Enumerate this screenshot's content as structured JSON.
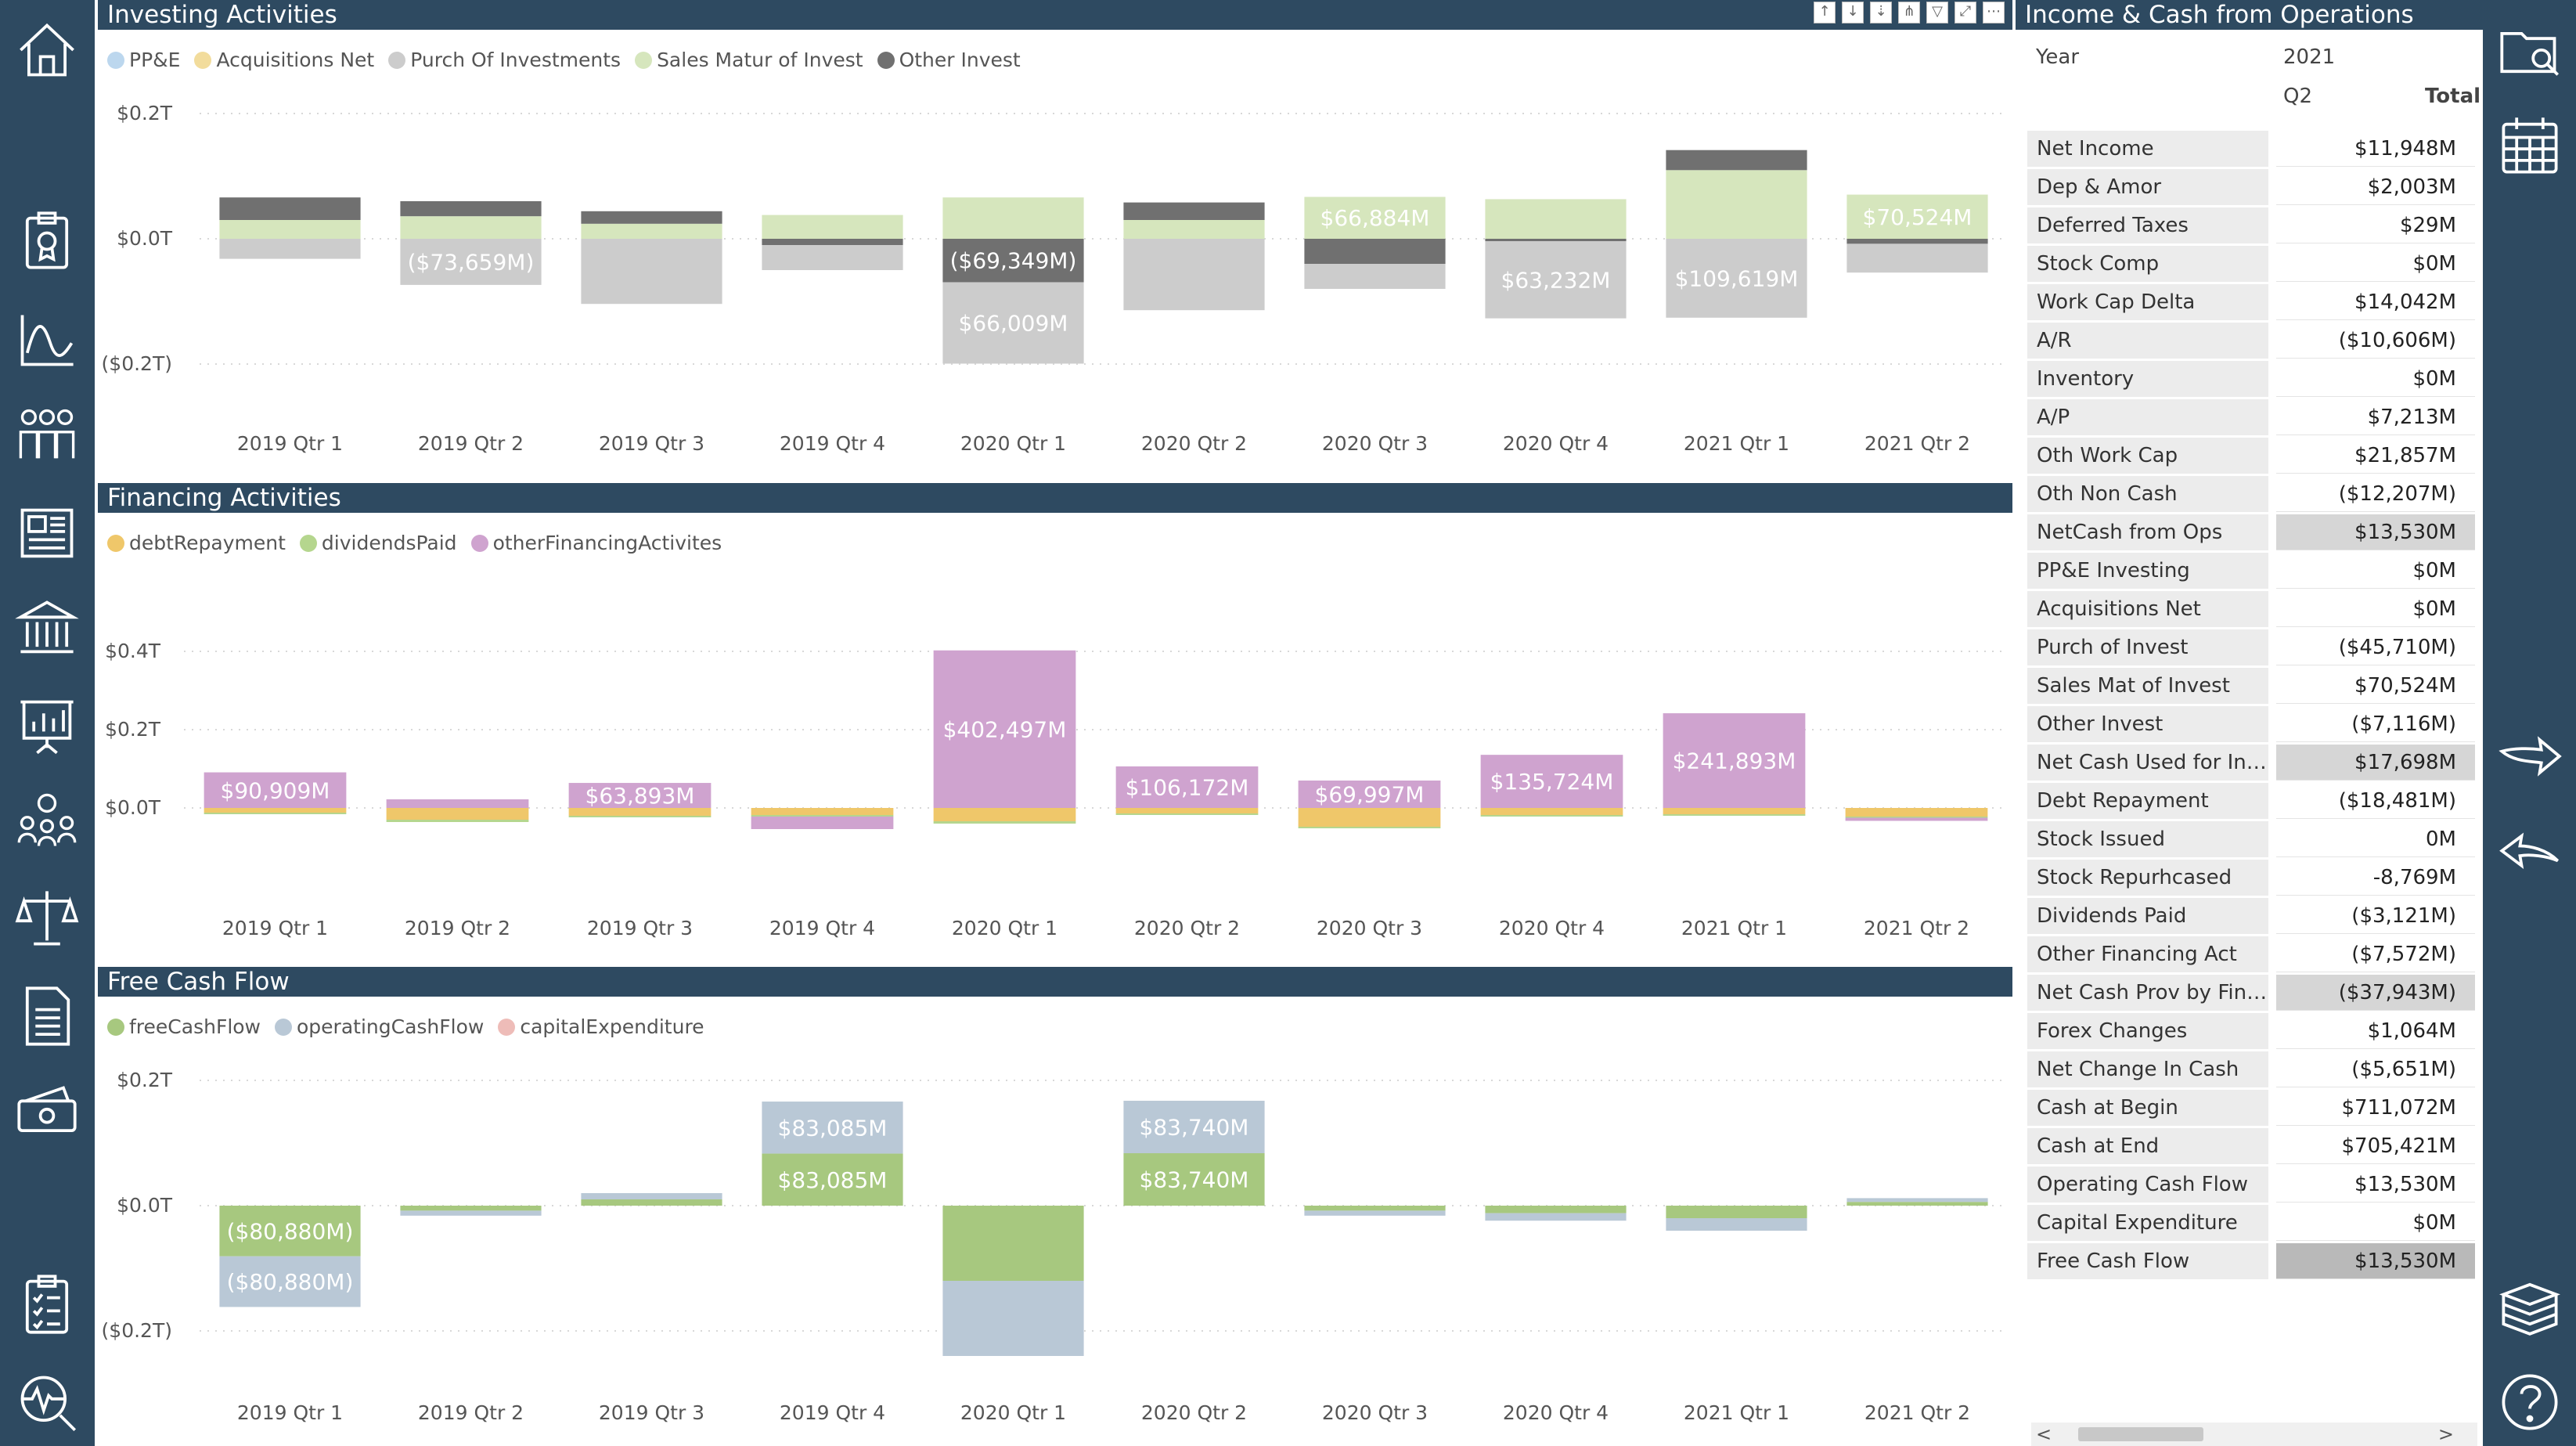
{
  "left_rail": {
    "icons": [
      "home-icon",
      "clipboard-award-icon",
      "line-chart-icon",
      "people-group-icon",
      "newspaper-icon",
      "bank-icon",
      "presentation-icon",
      "team-idea-icon",
      "scales-icon",
      "document-icon",
      "money-icon",
      "checklist-icon",
      "health-monitor-icon"
    ]
  },
  "right_rail": {
    "icons": [
      "folder-search-icon",
      "calendar-icon",
      "arrow-right-icon",
      "arrow-left-icon",
      "books-stack-icon",
      "help-icon"
    ]
  },
  "colors": {
    "header_bg": "#2e4a61",
    "ppe": "#bcd7ee",
    "acq_net": "#f2dc9c",
    "purch_invest": "#cccccc",
    "sales_matur": "#d6e6bd",
    "other_invest": "#707070",
    "debt_repayment": "#efc76a",
    "dividends_paid": "#b5d68e",
    "other_financing": "#cfa3cf",
    "free_cash_flow": "#a7c87f",
    "operating_cash_flow": "#b9c8d6",
    "capital_expenditure": "#eebcb8"
  },
  "investing": {
    "title": "Investing Activities",
    "legend": [
      "PP&E",
      "Acquisitions Net",
      "Purch Of Investments",
      "Sales Matur of Invest",
      "Other Invest"
    ]
  },
  "financing": {
    "title": "Financing Activities",
    "legend": [
      "debtRepayment",
      "dividendsPaid",
      "otherFinancingActivites"
    ]
  },
  "fcf": {
    "title": "Free Cash Flow",
    "legend": [
      "freeCashFlow",
      "operatingCashFlow",
      "capitalExpenditure"
    ]
  },
  "chart_data": [
    {
      "type": "bar",
      "stacked": true,
      "title": "Investing Activities",
      "categories": [
        "2019 Qtr 1",
        "2019 Qtr 2",
        "2019 Qtr 3",
        "2019 Qtr 4",
        "2020 Qtr 1",
        "2020 Qtr 2",
        "2020 Qtr 3",
        "2020 Qtr 4",
        "2021 Qtr 1",
        "2021 Qtr 2"
      ],
      "y_tick_labels": [
        "$0.2T",
        "$0.0T",
        "($0.2T)"
      ],
      "ylim": [
        -0.2,
        0.2
      ],
      "grid": true,
      "legend_position": "top-left",
      "series": [
        {
          "name": "Sales Matur of Invest",
          "values": [
            30000,
            36000,
            24000,
            38000,
            66009,
            30000,
            66884,
            63232,
            109619,
            70524
          ]
        },
        {
          "name": "Other Invest",
          "values": [
            36000,
            24000,
            20000,
            -10000,
            -69349,
            28000,
            -40000,
            -4000,
            32000,
            -8000
          ]
        },
        {
          "name": "Purch Of Investments",
          "values": [
            -32000,
            -73659,
            -104000,
            -40000,
            -130000,
            -114000,
            -40000,
            -123000,
            -126000,
            -46000
          ]
        }
      ],
      "data_labels": [
        {
          "category": "2019 Qtr 2",
          "text": "($73,659M)"
        },
        {
          "category": "2020 Qtr 1",
          "text": "$66,009M"
        },
        {
          "category": "2020 Qtr 1",
          "text": "($69,349M)"
        },
        {
          "category": "2020 Qtr 3",
          "text": "$66,884M"
        },
        {
          "category": "2020 Qtr 4",
          "text": "$63,232M"
        },
        {
          "category": "2021 Qtr 1",
          "text": "$109,619M"
        },
        {
          "category": "2021 Qtr 2",
          "text": "$70,524M"
        }
      ]
    },
    {
      "type": "bar",
      "stacked": true,
      "title": "Financing Activities",
      "categories": [
        "2019 Qtr 1",
        "2019 Qtr 2",
        "2019 Qtr 3",
        "2019 Qtr 4",
        "2020 Qtr 1",
        "2020 Qtr 2",
        "2020 Qtr 3",
        "2020 Qtr 4",
        "2021 Qtr 1",
        "2021 Qtr 2"
      ],
      "y_tick_labels": [
        "$0.4T",
        "$0.2T",
        "$0.0T"
      ],
      "ylim": [
        -0.1,
        0.45
      ],
      "grid": true,
      "legend_position": "top-left",
      "series": [
        {
          "name": "debtRepayment",
          "values": [
            -12000,
            -30000,
            -20000,
            -18000,
            -34000,
            -14000,
            -48000,
            -18000,
            -16000,
            -22000
          ]
        },
        {
          "name": "dividendsPaid",
          "values": [
            -4000,
            -6000,
            -4000,
            -4000,
            -6000,
            -4000,
            -4000,
            -4000,
            -4000,
            -3000
          ]
        },
        {
          "name": "otherFinancingActivites",
          "values": [
            90909,
            22000,
            63893,
            -32000,
            402497,
            106172,
            69997,
            135724,
            241893,
            -8000
          ]
        }
      ],
      "data_labels": [
        {
          "category": "2019 Qtr 1",
          "text": "$90,909M"
        },
        {
          "category": "2019 Qtr 3",
          "text": "$63,893M"
        },
        {
          "category": "2020 Qtr 1",
          "text": "$402,497M"
        },
        {
          "category": "2020 Qtr 2",
          "text": "$106,172M"
        },
        {
          "category": "2020 Qtr 3",
          "text": "$69,997M"
        },
        {
          "category": "2020 Qtr 4",
          "text": "$135,724M"
        },
        {
          "category": "2021 Qtr 1",
          "text": "$241,893M"
        }
      ]
    },
    {
      "type": "bar",
      "stacked": true,
      "title": "Free Cash Flow",
      "categories": [
        "2019 Qtr 1",
        "2019 Qtr 2",
        "2019 Qtr 3",
        "2019 Qtr 4",
        "2020 Qtr 1",
        "2020 Qtr 2",
        "2020 Qtr 3",
        "2020 Qtr 4",
        "2021 Qtr 1",
        "2021 Qtr 2"
      ],
      "y_tick_labels": [
        "$0.2T",
        "$0.0T",
        "($0.2T)"
      ],
      "ylim": [
        -0.2,
        0.2
      ],
      "grid": true,
      "legend_position": "top-left",
      "series": [
        {
          "name": "freeCashFlow",
          "values": [
            -80880,
            -8000,
            10000,
            83085,
            -120000,
            83740,
            -8000,
            -12000,
            -20000,
            6000
          ]
        },
        {
          "name": "operatingCashFlow",
          "values": [
            -80880,
            -8000,
            10000,
            83085,
            -120000,
            83740,
            -8000,
            -12000,
            -20000,
            6000
          ]
        }
      ],
      "data_labels": [
        {
          "category": "2019 Qtr 1",
          "text": "($80,880M)"
        },
        {
          "category": "2019 Qtr 1",
          "text": "($80,880M)"
        },
        {
          "category": "2019 Qtr 4",
          "text": "$83,085M"
        },
        {
          "category": "2019 Qtr 4",
          "text": "$83,085M"
        },
        {
          "category": "2020 Qtr 2",
          "text": "$83,740M"
        },
        {
          "category": "2020 Qtr 2",
          "text": "$83,740M"
        }
      ]
    }
  ],
  "matrix": {
    "title": "Income & Cash from Operations",
    "year_label": "Year",
    "year_value": "2021",
    "quarter": "Q2",
    "total_label": "Total",
    "rows": [
      {
        "label": "Net Income",
        "value": "$11,948M"
      },
      {
        "label": "Dep & Amor",
        "value": "$2,003M"
      },
      {
        "label": "Deferred Taxes",
        "value": "$29M"
      },
      {
        "label": "Stock Comp",
        "value": "$0M"
      },
      {
        "label": "Work Cap Delta",
        "value": "$14,042M"
      },
      {
        "label": "A/R",
        "value": "($10,606M)"
      },
      {
        "label": "Inventory",
        "value": "$0M"
      },
      {
        "label": "A/P",
        "value": "$7,213M"
      },
      {
        "label": "Oth Work Cap",
        "value": "$21,857M"
      },
      {
        "label": "Oth Non Cash",
        "value": "($12,207M)"
      },
      {
        "label": "NetCash from Ops",
        "value": "$13,530M",
        "highlight": true
      },
      {
        "label": "PP&E Investing",
        "value": "$0M"
      },
      {
        "label": "Acquisitions Net",
        "value": "$0M"
      },
      {
        "label": "Purch of Invest",
        "value": "($45,710M)"
      },
      {
        "label": "Sales Mat of Invest",
        "value": "$70,524M"
      },
      {
        "label": "Other Invest",
        "value": "($7,116M)"
      },
      {
        "label": "Net Cash Used for Inv...",
        "value": "$17,698M",
        "highlight": true
      },
      {
        "label": "Debt Repayment",
        "value": "($18,481M)"
      },
      {
        "label": "Stock Issued",
        "value": "0M"
      },
      {
        "label": "Stock Repurhcased",
        "value": "-8,769M"
      },
      {
        "label": "Dividends Paid",
        "value": "($3,121M)"
      },
      {
        "label": "Other Financing Act",
        "value": "($7,572M)"
      },
      {
        "label": "Net Cash Prov by Fina...",
        "value": "($37,943M)",
        "highlight": true
      },
      {
        "label": "Forex Changes",
        "value": "$1,064M"
      },
      {
        "label": "Net Change In Cash",
        "value": "($5,651M)"
      },
      {
        "label": "Cash at Begin",
        "value": "$711,072M"
      },
      {
        "label": "Cash at End",
        "value": "$705,421M"
      },
      {
        "label": "Operating Cash Flow",
        "value": "$13,530M"
      },
      {
        "label": "Capital Expenditure",
        "value": "$0M"
      },
      {
        "label": "Free Cash Flow",
        "value": "$13,530M",
        "highlight2": true
      }
    ],
    "scroll_left": "<",
    "scroll_right": ">"
  }
}
